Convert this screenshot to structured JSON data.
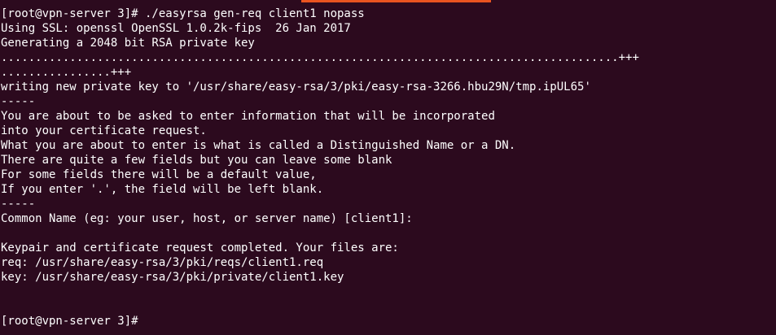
{
  "theme": {
    "background": "#2c0a1e",
    "foreground": "#ffffff",
    "tab_indicator": "#e95420"
  },
  "terminal": {
    "lines": [
      "[root@vpn-server 3]# ./easyrsa gen-req client1 nopass",
      "Using SSL: openssl OpenSSL 1.0.2k-fips  26 Jan 2017",
      "Generating a 2048 bit RSA private key",
      "..........................................................................................+++",
      "................+++",
      "writing new private key to '/usr/share/easy-rsa/3/pki/easy-rsa-3266.hbu29N/tmp.ipUL65'",
      "-----",
      "You are about to be asked to enter information that will be incorporated",
      "into your certificate request.",
      "What you are about to enter is what is called a Distinguished Name or a DN.",
      "There are quite a few fields but you can leave some blank",
      "For some fields there will be a default value,",
      "If you enter '.', the field will be left blank.",
      "-----",
      "Common Name (eg: your user, host, or server name) [client1]:",
      "",
      "Keypair and certificate request completed. Your files are:",
      "req: /usr/share/easy-rsa/3/pki/reqs/client1.req",
      "key: /usr/share/easy-rsa/3/pki/private/client1.key",
      "",
      "",
      "[root@vpn-server 3]#"
    ]
  }
}
